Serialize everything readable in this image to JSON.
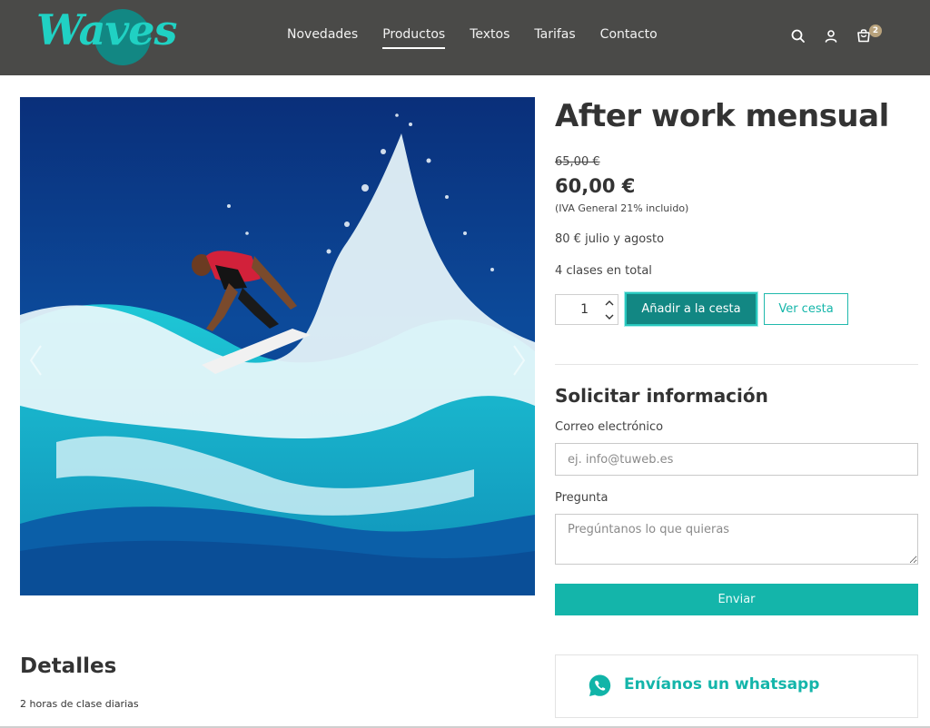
{
  "header": {
    "logo_text": "Waves",
    "nav": [
      {
        "label": "Novedades",
        "active": false
      },
      {
        "label": "Productos",
        "active": true
      },
      {
        "label": "Textos",
        "active": false
      },
      {
        "label": "Tarifas",
        "active": false
      },
      {
        "label": "Contacto",
        "active": false
      }
    ],
    "icons": [
      "search-icon",
      "user-icon",
      "cart-icon"
    ],
    "cart_count": "2"
  },
  "product": {
    "image_alt": "surfer-wave-photo",
    "title": "After work mensual",
    "old_price": "65,00 €",
    "price": "60,00 €",
    "tax_note": "(IVA General 21% incluido)",
    "description_lines": [
      "80 € julio y agosto",
      "4 clases en total"
    ],
    "quantity": "1",
    "add_to_cart_label": "Añadir a la cesta",
    "view_cart_label": "Ver cesta"
  },
  "info_form": {
    "title": "Solicitar información",
    "email_label": "Correo electrónico",
    "email_placeholder": "ej. info@tuweb.es",
    "question_label": "Pregunta",
    "question_placeholder": "Pregúntanos lo que quieras",
    "submit_label": "Enviar"
  },
  "details": {
    "title": "Detalles",
    "text": "2 horas de clase diarias"
  },
  "whatsapp": {
    "label": "Envíanos un whatsapp"
  },
  "colors": {
    "header_bg": "#4a4a48",
    "accent": "#14b5aa",
    "accent_dark": "#128783",
    "badge": "#b8a27c"
  }
}
